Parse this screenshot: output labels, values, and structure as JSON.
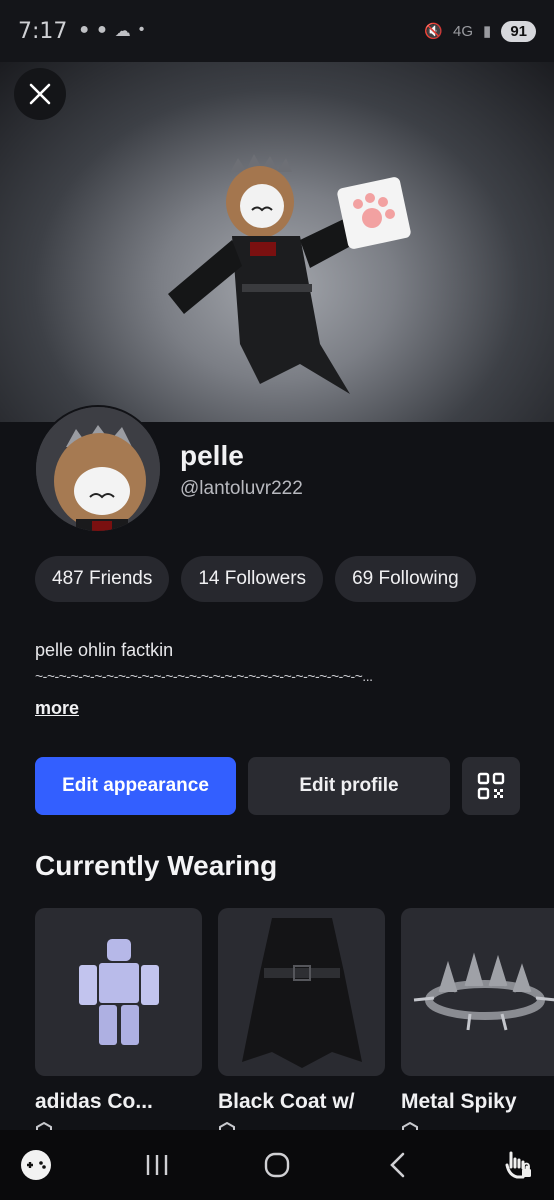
{
  "status_bar": {
    "time": "7:17",
    "network": "4G",
    "battery": "91"
  },
  "profile": {
    "display_name": "pelle",
    "username": "@lantoluvr222",
    "stats": {
      "friends": "487 Friends",
      "followers": "14 Followers",
      "following": "69 Following"
    },
    "bio_line1": "pelle ohlin factkin",
    "bio_line2": "~-~-~-~-~-~-~-~-~-~-~-~-~-~-~-~-~-~-~-~-~-~-~-~-~-~-~-~...",
    "more_label": "more"
  },
  "actions": {
    "edit_appearance": "Edit appearance",
    "edit_profile": "Edit profile"
  },
  "currently_wearing": {
    "title": "Currently Wearing",
    "items": [
      {
        "name": "adidas Co...",
        "price": ""
      },
      {
        "name": "Black Coat w/",
        "price": ""
      },
      {
        "name": "Metal Spiky",
        "price": ""
      }
    ]
  },
  "colors": {
    "accent": "#335fff",
    "panel_bg": "#111216",
    "pill_bg": "#27282e"
  },
  "icons": [
    "close-icon",
    "qr-code-icon",
    "robux-icon",
    "game-controller-icon",
    "recent-apps-icon",
    "home-icon",
    "back-icon",
    "hand-lock-icon"
  ]
}
